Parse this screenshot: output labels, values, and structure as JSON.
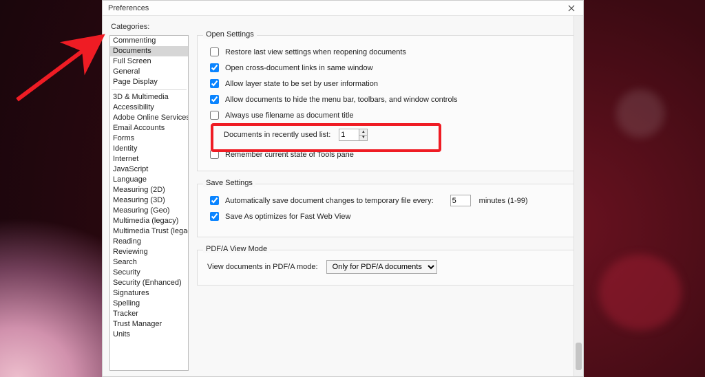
{
  "dialog": {
    "title": "Preferences",
    "categories_label": "Categories:"
  },
  "sidebar": {
    "top": [
      "Commenting",
      "Documents",
      "Full Screen",
      "General",
      "Page Display"
    ],
    "rest": [
      "3D & Multimedia",
      "Accessibility",
      "Adobe Online Services",
      "Email Accounts",
      "Forms",
      "Identity",
      "Internet",
      "JavaScript",
      "Language",
      "Measuring (2D)",
      "Measuring (3D)",
      "Measuring (Geo)",
      "Multimedia (legacy)",
      "Multimedia Trust (legacy)",
      "Reading",
      "Reviewing",
      "Search",
      "Security",
      "Security (Enhanced)",
      "Signatures",
      "Spelling",
      "Tracker",
      "Trust Manager",
      "Units"
    ],
    "selected": "Documents"
  },
  "open_settings": {
    "legend": "Open Settings",
    "restore_last": {
      "label": "Restore last view settings when reopening documents",
      "checked": false
    },
    "cross_doc": {
      "label": "Open cross-document links in same window",
      "checked": true
    },
    "layer_state": {
      "label": "Allow layer state to be set by user information",
      "checked": true
    },
    "hide_menu": {
      "label": "Allow documents to hide the menu bar, toolbars, and window controls",
      "checked": true
    },
    "filename_title": {
      "label": "Always use filename as document title",
      "checked": false
    },
    "recent": {
      "label": "Documents in recently used list:",
      "value": "1"
    },
    "remember_files": {
      "label": "Remember current state of Tools pane",
      "checked": false
    }
  },
  "save_settings": {
    "legend": "Save Settings",
    "autosave": {
      "label": "Automatically save document changes to temporary file every:",
      "checked": true,
      "value": "5",
      "suffix": "minutes (1-99)"
    },
    "fastweb": {
      "label": "Save As optimizes for Fast Web View",
      "checked": true
    }
  },
  "pdfa": {
    "legend": "PDF/A View Mode",
    "label": "View documents in PDF/A mode:",
    "selected": "Only for PDF/A documents"
  }
}
